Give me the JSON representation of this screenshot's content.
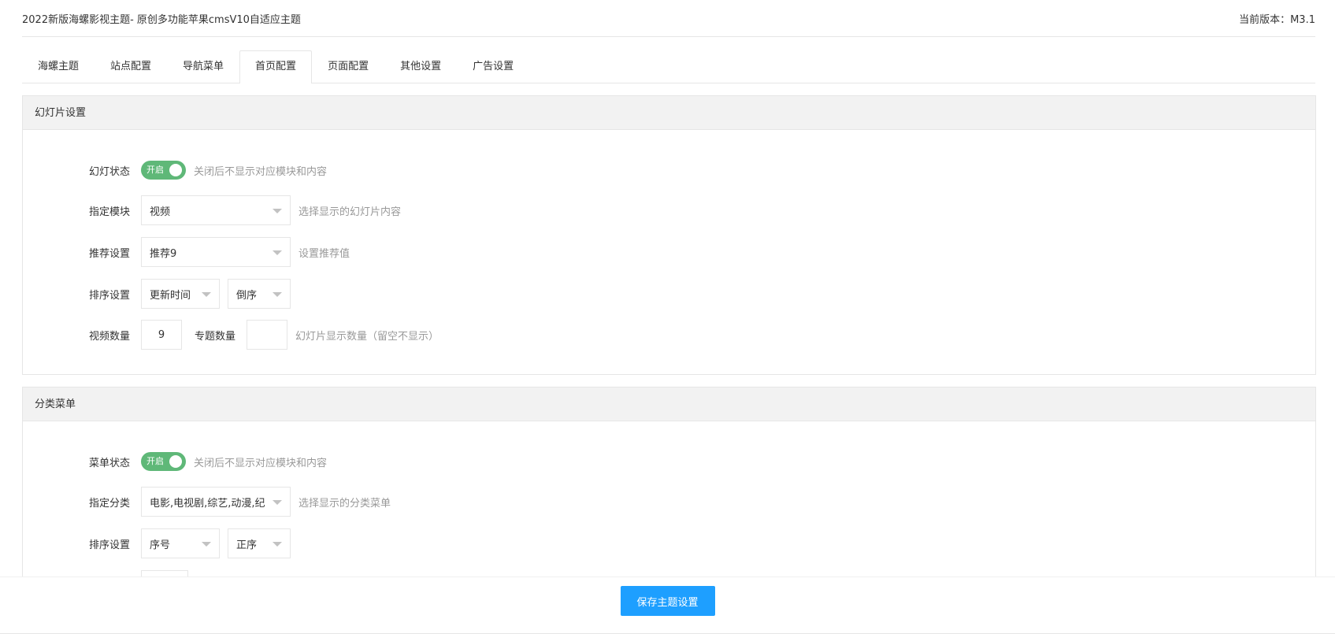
{
  "header": {
    "title": "2022新版海螺影视主题- 原创多功能苹果cmsV10自适应主题",
    "version": "当前版本：M3.1"
  },
  "tabs": [
    {
      "label": "海螺主题",
      "active": false
    },
    {
      "label": "站点配置",
      "active": false
    },
    {
      "label": "导航菜单",
      "active": false
    },
    {
      "label": "首页配置",
      "active": true
    },
    {
      "label": "页面配置",
      "active": false
    },
    {
      "label": "其他设置",
      "active": false
    },
    {
      "label": "广告设置",
      "active": false
    }
  ],
  "slideshow": {
    "title": "幻灯片设置",
    "status": {
      "label": "幻灯状态",
      "switch_text": "开启",
      "on": true,
      "hint": "关闭后不显示对应模块和内容"
    },
    "module": {
      "label": "指定模块",
      "value": "视频",
      "hint": "选择显示的幻灯片内容"
    },
    "recommend": {
      "label": "推荐设置",
      "value": "推荐9",
      "hint": "设置推荐值"
    },
    "sort": {
      "label": "排序设置",
      "field": "更新时间",
      "order": "倒序"
    },
    "count": {
      "label": "视频数量",
      "video_value": "9",
      "topic_label": "专题数量",
      "topic_value": "",
      "hint": "幻灯片显示数量（留空不显示）"
    }
  },
  "category": {
    "title": "分类菜单",
    "status": {
      "label": "菜单状态",
      "switch_text": "开启",
      "on": true,
      "hint": "关闭后不显示对应模块和内容"
    },
    "categories": {
      "label": "指定分类",
      "value": "电影,电视剧,综艺,动漫,纪",
      "hint": "选择显示的分类菜单"
    },
    "sort": {
      "label": "排序设置",
      "field": "序号",
      "order": "正序"
    }
  },
  "footer": {
    "save_label": "保存主题设置"
  },
  "colors": {
    "switch_on": "#5fb878",
    "primary_button": "#1e9fff",
    "panel_header_bg": "#f2f2f2",
    "border": "#e6e6e6",
    "hint_text": "#999999"
  }
}
